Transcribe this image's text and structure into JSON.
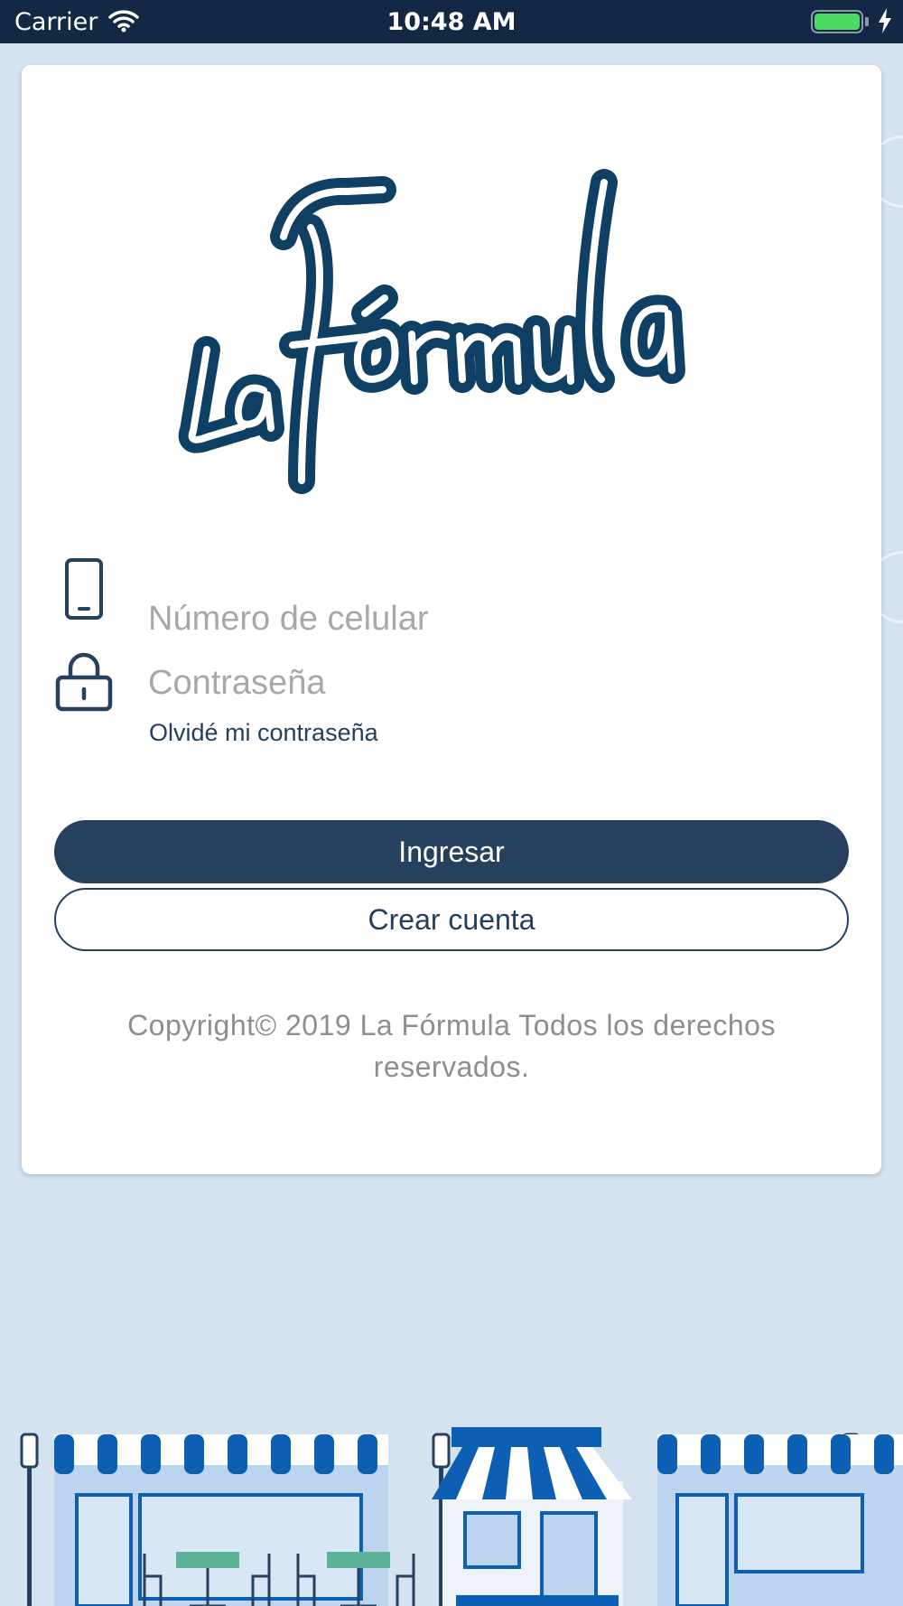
{
  "status_bar": {
    "carrier": "Carrier",
    "time": "10:48 AM",
    "battery_level": 1.0,
    "charging": true
  },
  "logo": {
    "text": "La Fórmula",
    "color": "#0f3f63"
  },
  "form": {
    "phone_placeholder": "Número de celular",
    "phone_value": "",
    "password_placeholder": "Contraseña",
    "password_value": "",
    "forgot_password": "Olvidé mi contraseña"
  },
  "buttons": {
    "login": "Ingresar",
    "create_account": "Crear cuenta"
  },
  "footer": {
    "copyright": "Copyright© 2019 La Fórmula Todos los derechos reservados."
  },
  "icons": {
    "phone": "mobile-phone-icon",
    "password": "lock-icon"
  },
  "colors": {
    "primary": "#26405e",
    "status_bar": "#132843",
    "background": "#d5e3f1",
    "awning_blue": "#0d5fb4"
  }
}
